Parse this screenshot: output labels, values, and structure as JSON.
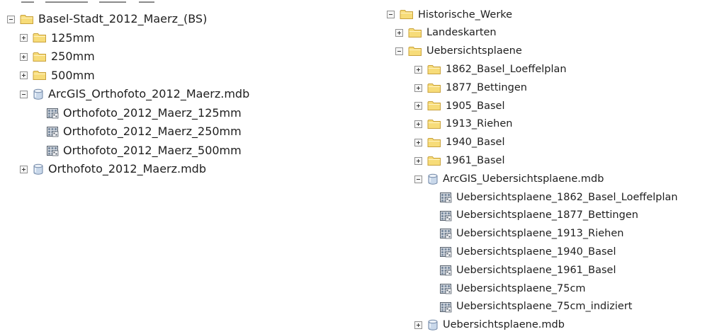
{
  "left_tree": {
    "root": "Basel-Stadt_2012_Maerz_(BS)",
    "folders": [
      "125mm",
      "250mm",
      "500mm"
    ],
    "database": {
      "label": "ArcGIS_Orthofoto_2012_Maerz.mdb",
      "rasters": [
        "Orthofoto_2012_Maerz_125mm",
        "Orthofoto_2012_Maerz_250mm",
        "Orthofoto_2012_Maerz_500mm"
      ]
    },
    "database2": "Orthofoto_2012_Maerz.mdb"
  },
  "right_tree": {
    "root": "Historische_Werke",
    "landeskarten": "Landeskarten",
    "uebersichtsplaene": "Uebersichtsplaene",
    "folders": [
      "1862_Basel_Loeffelplan",
      "1877_Bettingen",
      "1905_Basel",
      "1913_Riehen",
      "1940_Basel",
      "1961_Basel"
    ],
    "database": {
      "label": "ArcGIS_Uebersichtsplaene.mdb",
      "rasters": [
        "Uebersichtsplaene_1862_Basel_Loeffelplan",
        "Uebersichtsplaene_1877_Bettingen",
        "Uebersichtsplaene_1913_Riehen",
        "Uebersichtsplaene_1940_Basel",
        "Uebersichtsplaene_1961_Basel",
        "Uebersichtsplaene_75cm",
        "Uebersichtsplaene_75cm_indiziert"
      ]
    },
    "database2": "Uebersichtsplaene.mdb"
  },
  "icons": {
    "expand": "expand-icon",
    "collapse": "collapse-icon",
    "folder": "folder-icon",
    "database": "database-icon",
    "raster": "raster-dataset-icon"
  },
  "colors": {
    "folder_fill": "#f7dc79",
    "folder_border": "#c9a23c",
    "database_fill": "#c9d8ea",
    "database_border": "#6f86a6",
    "raster_fill": "#7c8da1"
  }
}
